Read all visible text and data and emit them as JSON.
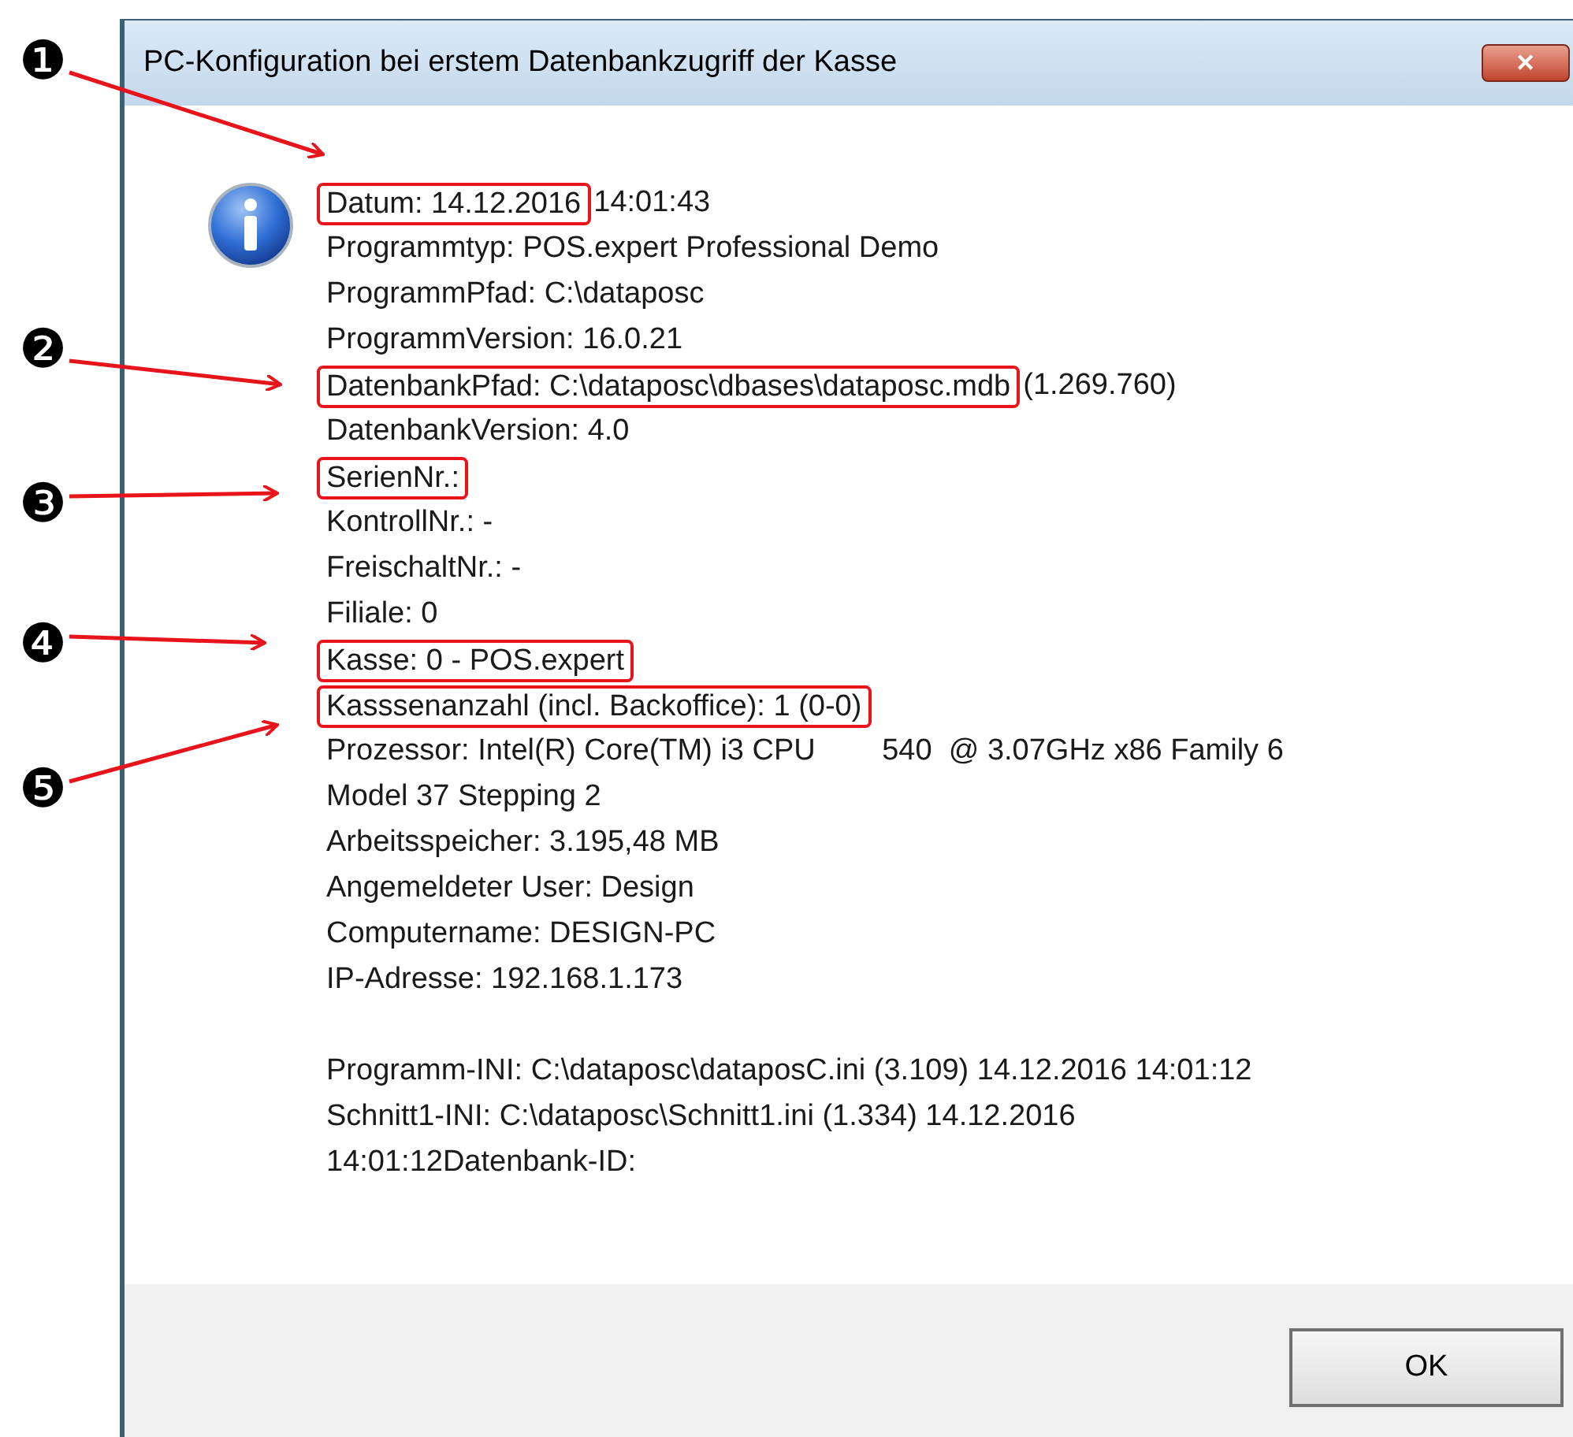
{
  "window": {
    "title": "PC-Konfiguration bei erstem Datenbankzugriff der Kasse",
    "close": "✕"
  },
  "info_lines": [
    {
      "marked": "Datum: 14.12.2016",
      "rest": "14:01:43",
      "callout": "❶"
    },
    {
      "text": "Programmtyp: POS.expert Professional Demo"
    },
    {
      "text": "ProgrammPfad: C:\\dataposc"
    },
    {
      "text": "ProgrammVersion: 16.0.21"
    },
    {
      "marked": "DatenbankPfad: C:\\dataposc\\dbases\\dataposc.mdb",
      "rest": "(1.269.760)",
      "callout": "❷"
    },
    {
      "text": "DatenbankVersion: 4.0"
    },
    {
      "marked": "SerienNr.:",
      "callout": "❸"
    },
    {
      "text": "KontrollNr.: -"
    },
    {
      "text": "FreischaltNr.: -"
    },
    {
      "text": "Filiale: 0"
    },
    {
      "marked": "Kasse: 0 - POS.expert",
      "callout": "❹"
    },
    {
      "marked": "Kasssenanzahl (incl. Backoffice): 1 (0-0)",
      "callout": "❺"
    },
    {
      "text": "Prozessor: Intel(R) Core(TM) i3 CPU        540  @ 3.07GHz x86 Family 6"
    },
    {
      "text": "Model 37 Stepping 2"
    },
    {
      "text": "Arbeitsspeicher: 3.195,48 MB"
    },
    {
      "text": "Angemeldeter User: Design"
    },
    {
      "text": "Computername: DESIGN-PC"
    },
    {
      "text": "IP-Adresse: 192.168.1.173"
    }
  ],
  "ini_lines": [
    {
      "text": "Programm-INI: C:\\dataposc\\dataposC.ini (3.109) 14.12.2016 14:01:12"
    },
    {
      "text": "Schnitt1-INI: C:\\dataposc\\Schnitt1.ini (1.334) 14.12.2016"
    },
    {
      "text": "14:01:12Datenbank-ID:"
    }
  ],
  "buttons": [
    "OK"
  ]
}
